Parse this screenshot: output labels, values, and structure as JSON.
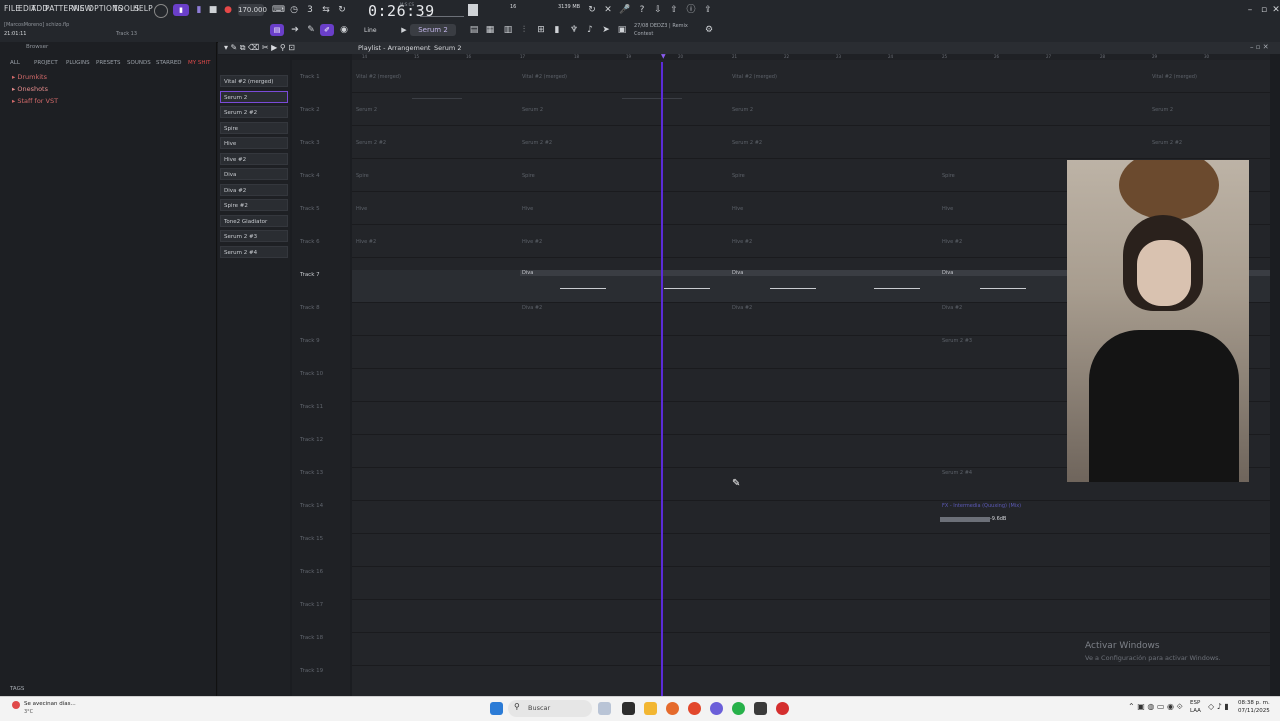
{
  "menu": [
    "FILE",
    "EDIT",
    "ADD",
    "PATTERNS",
    "VIEW",
    "OPTIONS",
    "TOOLS",
    "HELP"
  ],
  "project": {
    "user": "[MarcosMoreno] schizo.flp",
    "time_small": "21:01:11",
    "track_hint": "Track 13"
  },
  "transport": {
    "tempo": "170.000",
    "time": "0:26:39",
    "time_unit": "M:S:CS",
    "cpu_ram": "3139 MB",
    "voices": "16"
  },
  "toolbar": {
    "snap_mode": "Line",
    "pattern": "Serum 2",
    "hint_line1": "27/08  DEDZ3 | Remix",
    "hint_line2": "Contest"
  },
  "browser": {
    "title": "Browser",
    "tabs": [
      "ALL",
      "PROJECT",
      "PLUGINS",
      "PRESETS",
      "SOUNDS",
      "STARRED",
      "MY SHIT"
    ],
    "items": [
      "Drumkits",
      "Oneshots",
      "Staff for VST"
    ],
    "footer": "TAGS"
  },
  "playlist": {
    "title": "Playlist - Arrangement",
    "breadcrumb": "Serum 2",
    "channels": [
      "Vital #2 (merged)",
      "Serum 2",
      "Serum 2 #2",
      "Spire",
      "Hive",
      "Hive #2",
      "Diva",
      "Diva #2",
      "Spire #2",
      "Tone2 Gladiator",
      "Serum 2 #3",
      "Serum 2 #4"
    ],
    "tracks": [
      "Track 1",
      "Track 2",
      "Track 3",
      "Track 4",
      "Track 5",
      "Track 6",
      "Track 7",
      "Track 8",
      "Track 9",
      "Track 10",
      "Track 11",
      "Track 12",
      "Track 13",
      "Track 14",
      "Track 15",
      "Track 16",
      "Track 17",
      "Track 18",
      "Track 19"
    ],
    "ruler": [
      "14",
      "15",
      "16",
      "17",
      "18",
      "19",
      "20",
      "21",
      "22",
      "23",
      "24",
      "25",
      "26",
      "27",
      "28",
      "29",
      "30"
    ],
    "clips_vital": "Vital #2 (merged)",
    "clips_serum": "Serum 2",
    "clips_serum2": "Serum 2 #2",
    "clips_spire": "Spire",
    "clips_hive": "Hive",
    "clips_hive2": "Hive #2",
    "clips_diva": "Diva",
    "clips_diva2": "Diva #2",
    "clips_serum3": "Serum 2 #3",
    "clips_serum4": "Serum 2 #4",
    "automation": "FX - Intermedia (Quuxing) (Mix)",
    "automation_value": "-9.6dB"
  },
  "watermark": {
    "line1": "Activar Windows",
    "line2": "Ve a Configuración para activar Windows."
  },
  "taskbar": {
    "weather": "Se avecinan días...",
    "weather_sub": "3°C",
    "search": "Buscar",
    "lang": "ESP",
    "lang_sub": "LAA",
    "clock": "08:38 p. m.",
    "date": "07/11/2025"
  }
}
